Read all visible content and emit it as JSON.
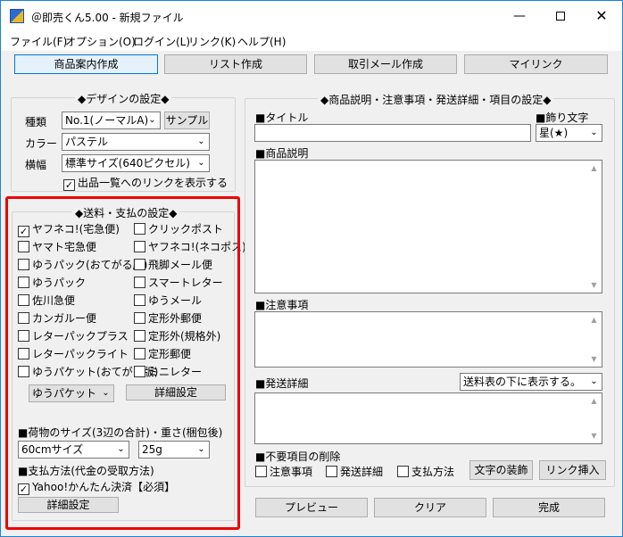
{
  "window": {
    "title": "＠即売くん5.00 - 新規ファイル"
  },
  "menu": [
    "ファイル(F)",
    "オプション(O)",
    "ログイン(L)",
    "リンク(K)",
    "ヘルプ(H)"
  ],
  "tabs": [
    "商品案内作成",
    "リスト作成",
    "取引メール作成",
    "マイリンク"
  ],
  "design": {
    "title": "◆デザインの設定◆",
    "type_label": "種類",
    "type_value": "No.1(ノーマルA)",
    "sample_button": "サンプル",
    "color_label": "カラー",
    "color_value": "パステル",
    "width_label": "横幅",
    "width_value": "標準サイズ(640ピクセル)",
    "link_checkbox": "出品一覧へのリンクを表示する"
  },
  "shipping": {
    "title": "◆送料・支払の設定◆",
    "left": [
      {
        "label": "ヤフネコ!(宅急便)",
        "checked": true
      },
      {
        "label": "ヤマト宅急便",
        "checked": false
      },
      {
        "label": "ゆうパック(おてがる版)",
        "checked": false
      },
      {
        "label": "ゆうパック",
        "checked": false
      },
      {
        "label": "佐川急便",
        "checked": false
      },
      {
        "label": "カンガルー便",
        "checked": false
      },
      {
        "label": "レターパックプラス",
        "checked": false
      },
      {
        "label": "レターパックライト",
        "checked": false
      },
      {
        "label": "ゆうパケット(おてがる版)",
        "checked": false
      }
    ],
    "right": [
      {
        "label": "クリックポスト",
        "checked": false
      },
      {
        "label": "ヤフネコ!(ネコポス)",
        "checked": false
      },
      {
        "label": "飛脚メール便",
        "checked": false
      },
      {
        "label": "スマートレター",
        "checked": false
      },
      {
        "label": "ゆうメール",
        "checked": false
      },
      {
        "label": "定形外郵便",
        "checked": false
      },
      {
        "label": "定形外(規格外)",
        "checked": false
      },
      {
        "label": "定形郵便",
        "checked": false
      },
      {
        "label": "ミニレター",
        "checked": false
      }
    ],
    "packet_select": "ゆうパケット",
    "detail_button": "詳細設定",
    "size_heading": "■荷物のサイズ(3辺の合計)・重さ(梱包後)",
    "size_value": "60cmサイズ",
    "weight_value": "25g",
    "payment_heading": "■支払方法(代金の受取方法)",
    "payment_checkbox": "Yahoo!かんたん決済【必須】",
    "payment_detail_button": "詳細設定"
  },
  "product": {
    "title": "◆商品説明・注意事項・発送詳細・項目の設定◆",
    "title_label": "■タイトル",
    "deco_label": "■飾り文字",
    "deco_value": "星(★)",
    "desc_label": "■商品説明",
    "notes_label": "■注意事項",
    "shipping_label": "■発送詳細",
    "shipping_position": "送料表の下に表示する。",
    "unused_label": "■不要項目の削除",
    "unused_checks": [
      "注意事項",
      "発送詳細",
      "支払方法"
    ],
    "text_deco_button": "文字の装飾",
    "link_insert_button": "リンク挿入"
  },
  "bottom_buttons": [
    "プレビュー",
    "クリア",
    "完成"
  ],
  "colors": {
    "highlight": "#e00000",
    "accent": "#0078d7"
  }
}
